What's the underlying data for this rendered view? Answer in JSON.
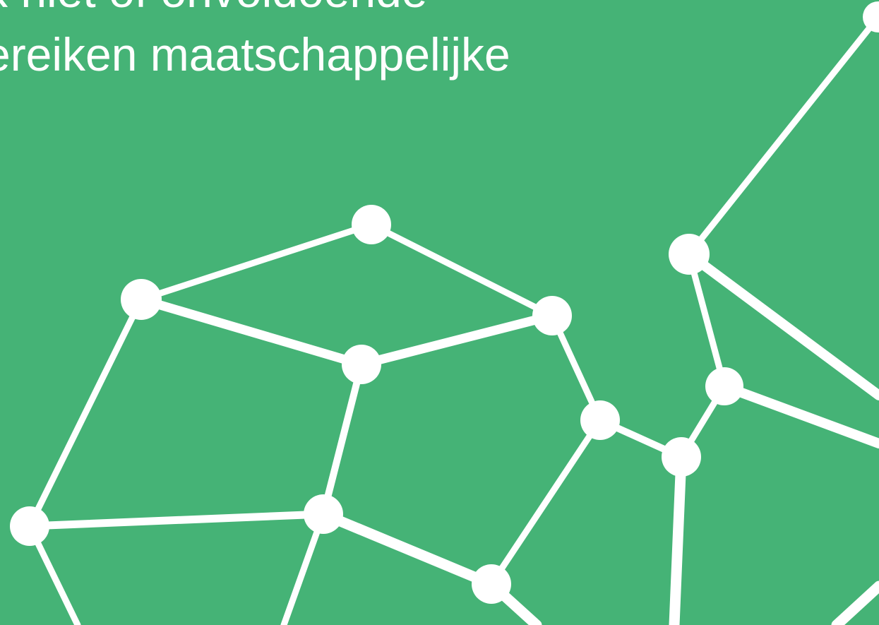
{
  "colors": {
    "background": "#45b376",
    "foreground": "#ffffff"
  },
  "headline": {
    "lines": [
      "k niet of onvoldoende",
      "ereiken maatschappelijke"
    ]
  },
  "graphic": {
    "description_icon": "network-graph-icon"
  }
}
